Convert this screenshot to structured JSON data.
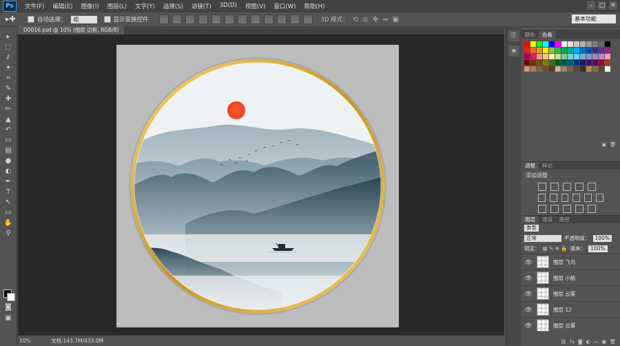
{
  "app": {
    "logo": "Ps"
  },
  "menu": [
    "文件(F)",
    "编辑(E)",
    "图像(I)",
    "图层(L)",
    "文字(Y)",
    "选择(S)",
    "滤镜(T)",
    "3D(D)",
    "视图(V)",
    "窗口(W)",
    "帮助(H)"
  ],
  "window_controls": {
    "minimize": "–",
    "maximize": "□",
    "close": "✕"
  },
  "options": {
    "auto_select_label": "自动选择：",
    "auto_select_value": "组",
    "show_transform_label": "显示变换控件",
    "mode_3d_label": "3D 模式：",
    "workspace": "基本功能"
  },
  "document": {
    "tab_title": "D0016.psd @ 10% (图层 边框, RGB/8)",
    "status_zoom": "10%",
    "status_doc": "文档:143.7M/433.0M"
  },
  "panels": {
    "color_tab": "颜色",
    "swatches_tab": "色板",
    "adjust_tab": "调整",
    "styles_tab": "样式",
    "adjust_title": "添加调整",
    "layers_tab": "图层",
    "channels_tab": "通道",
    "paths_tab": "路径",
    "filter_kind": "类型",
    "blend_mode": "正常",
    "opacity_label": "不透明度：",
    "opacity_value": "100%",
    "lock_label": "锁定：",
    "fill_label": "填充：",
    "fill_value": "100%"
  },
  "layers": [
    {
      "name": "图层 飞鸟"
    },
    {
      "name": "图层 小船"
    },
    {
      "name": "图层 云雾"
    },
    {
      "name": "图层 12"
    },
    {
      "name": "图层 云雾"
    }
  ],
  "swatch_colors": [
    "#ff0000",
    "#ffff00",
    "#00ff00",
    "#00ffff",
    "#0000ff",
    "#ff00ff",
    "#ffffff",
    "#e6e6e6",
    "#cccccc",
    "#b3b3b3",
    "#999999",
    "#808080",
    "#666666",
    "#000000",
    "#ed1c24",
    "#f26522",
    "#f7941d",
    "#fff200",
    "#8dc63f",
    "#39b54a",
    "#00a651",
    "#00a99d",
    "#00aeef",
    "#0072bc",
    "#0054a6",
    "#2e3192",
    "#662d91",
    "#92278f",
    "#9e005d",
    "#ed145b",
    "#f69679",
    "#fdc689",
    "#fff799",
    "#c4df9b",
    "#82ca9c",
    "#7accc8",
    "#6dcff6",
    "#7da7d9",
    "#8393ca",
    "#a186be",
    "#bd8cbf",
    "#f49ac1",
    "#790000",
    "#7b2e00",
    "#7d4900",
    "#827b00",
    "#406618",
    "#005e20",
    "#005952",
    "#005b7f",
    "#003471",
    "#1b1464",
    "#440e62",
    "#630460",
    "#9e0039",
    "#a0410d",
    "#c69c6d",
    "#a67c52",
    "#8c6239",
    "#754c24",
    "#603813",
    "#c7b299",
    "#998675",
    "#736357",
    "#534741",
    "#362f2d",
    "#b28850",
    "#8b6a3b",
    "#5b4a2b",
    "#ffffff"
  ]
}
